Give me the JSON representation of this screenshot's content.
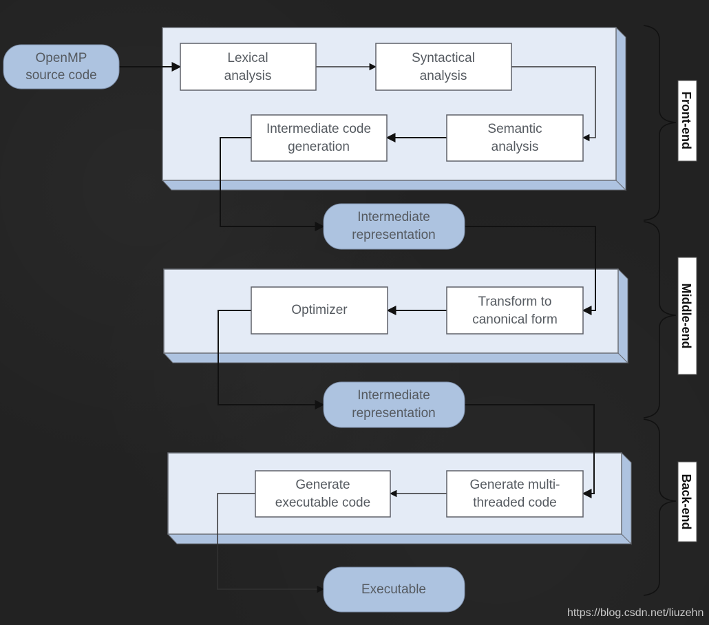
{
  "diagram": {
    "source": {
      "line1": "OpenMP",
      "line2": "source code"
    },
    "front_end": {
      "lexical": {
        "line1": "Lexical",
        "line2": "analysis"
      },
      "syntactical": {
        "line1": "Syntactical",
        "line2": "analysis"
      },
      "semantic": {
        "line1": "Semantic",
        "line2": "analysis"
      },
      "intermediate_codegen": {
        "line1": "Intermediate code",
        "line2": "generation"
      }
    },
    "ir_1": {
      "line1": "Intermediate",
      "line2": "representation"
    },
    "middle_end": {
      "transform": {
        "line1": "Transform to",
        "line2": "canonical form"
      },
      "optimizer": {
        "line1": "Optimizer"
      }
    },
    "ir_2": {
      "line1": "Intermediate",
      "line2": "representation"
    },
    "back_end": {
      "gen_multithreaded": {
        "line1": "Generate multi-",
        "line2": "threaded code"
      },
      "gen_executable": {
        "line1": "Generate",
        "line2": "executable code"
      }
    },
    "output": {
      "line1": "Executable"
    },
    "stages": {
      "front": "Front-end",
      "middle": "Middle-end",
      "back": "Back-end"
    },
    "colors": {
      "background": "#222222",
      "panel": "#e4ebf6",
      "panel_side": "#aec3e0",
      "terminal": "#adc3e0",
      "box": "#ffffff",
      "text": "#555a60"
    }
  },
  "watermark": "https://blog.csdn.net/liuzehn"
}
